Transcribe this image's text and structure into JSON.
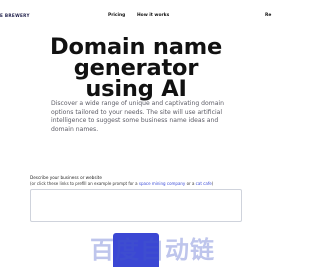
{
  "nav": {
    "brand": "E BREWERY",
    "links": [
      {
        "label": "Pricing"
      },
      {
        "label": "How it works"
      }
    ],
    "right_partial": "Re"
  },
  "hero": {
    "title_line1": "Domain name",
    "title_line2": "generator",
    "title_line3": "using AI",
    "intro": "Discover a wide range of unique and captivating domain options tailored to your needs. The site will use artificial intelligence to suggest some business name ideas and domain names."
  },
  "form": {
    "label": "Describe your business or website",
    "helper_prefix": "(or click these links to prefill an example prompt for a ",
    "example_1": "space mining company",
    "helper_or": " or a ",
    "example_2": "cat cafe",
    "helper_suffix": ")",
    "textarea_value": "",
    "textarea_placeholder": ""
  },
  "watermark": "百度自动链",
  "colors": {
    "accent": "#3b47d4",
    "link": "#3a4bd8",
    "muted_text": "#5c5c66"
  }
}
